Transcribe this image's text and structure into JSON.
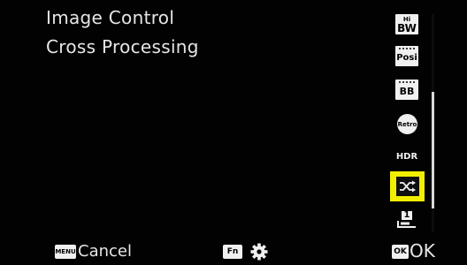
{
  "header": {
    "title": "Image Control",
    "subtitle": "Cross Processing"
  },
  "icons": [
    {
      "name": "hi-bw-icon",
      "top_label": "Hi",
      "label": "BW"
    },
    {
      "name": "posi-icon",
      "label": "Posi"
    },
    {
      "name": "bb-icon",
      "label": "BB"
    },
    {
      "name": "retro-icon",
      "label": "Retro"
    },
    {
      "name": "hdr-icon",
      "label": "HDR"
    },
    {
      "name": "cross-processing-icon",
      "label": "",
      "selected": true
    },
    {
      "name": "user-1-icon",
      "label": "1"
    }
  ],
  "footer": {
    "menu_badge": "MENU",
    "cancel_label": "Cancel",
    "fn_badge": "Fn",
    "ok_badge": "OK",
    "ok_label": "OK"
  },
  "colors": {
    "background": "#000000",
    "highlight": "#f2ee00",
    "text": "#e6e6e6"
  },
  "scroll": {
    "position_fraction": 0.36,
    "visible_fraction": 0.54
  }
}
